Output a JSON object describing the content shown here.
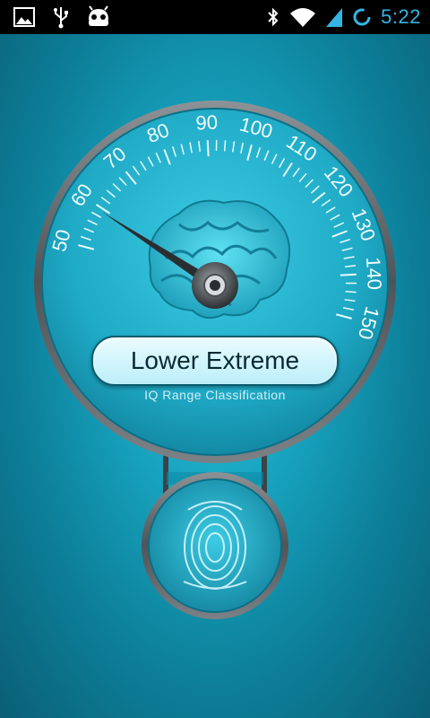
{
  "status_bar": {
    "time": "5:22",
    "icons": [
      "gallery-icon",
      "usb-icon",
      "android-icon",
      "bluetooth-icon",
      "wifi-icon",
      "signal-icon",
      "sync-ring-icon"
    ]
  },
  "gauge": {
    "ticks": [
      "50",
      "60",
      "70",
      "80",
      "90",
      "100",
      "110",
      "120",
      "130",
      "140",
      "150"
    ],
    "min": 50,
    "max": 150,
    "needle_value": 60,
    "center_icon": "brain-icon"
  },
  "result": {
    "label": "Lower Extreme",
    "subtitle": "IQ Range Classification"
  },
  "scanner": {
    "icon": "fingerprint-icon"
  },
  "colors": {
    "accent": "#33b5e5",
    "background": "#1aa9c4",
    "dial": "#2bb9d3",
    "rim": "#6a6f73"
  }
}
